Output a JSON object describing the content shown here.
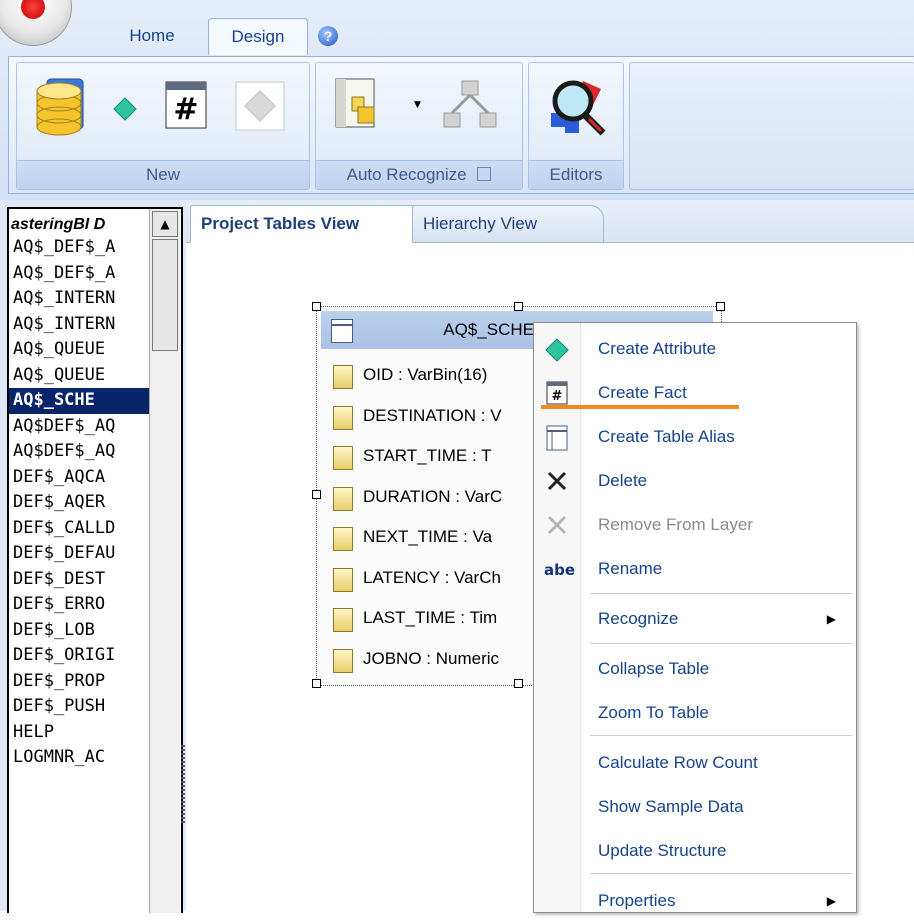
{
  "ribbon": {
    "tabs": [
      {
        "label": "Home"
      },
      {
        "label": "Design"
      }
    ],
    "help_glyph": "?",
    "groups": [
      {
        "label": "New"
      },
      {
        "label": "Auto Recognize"
      },
      {
        "label": "Editors"
      }
    ],
    "icons": [
      "database-icon",
      "attribute-diamond-icon",
      "fact-icon",
      "disabled-item-icon",
      "auto-recognize-icon",
      "hierarchy-icon",
      "editors-magnifier-icon"
    ]
  },
  "left_list": {
    "header": "asteringBI D",
    "items": [
      "AQ$_DEF$_A",
      "AQ$_DEF$_A",
      "AQ$_INTERN",
      "AQ$_INTERN",
      "AQ$_QUEUE",
      "AQ$_QUEUE",
      "AQ$_SCHE",
      "AQ$DEF$_AQ",
      "AQ$DEF$_AQ",
      "DEF$_AQCA",
      "DEF$_AQER",
      "DEF$_CALLD",
      "DEF$_DEFAU",
      "DEF$_DEST",
      "DEF$_ERRO",
      "DEF$_LOB",
      "DEF$_ORIGI",
      "DEF$_PROP",
      "DEF$_PUSH",
      "HELP",
      "LOGMNR_AC"
    ],
    "selected_index": 6
  },
  "view_tabs": [
    {
      "label": "Project Tables View"
    },
    {
      "label": "Hierarchy View"
    }
  ],
  "table": {
    "title": "AQ$_SCHEDULES",
    "columns": [
      "OID : VarBin(16)",
      "DESTINATION : V",
      "START_TIME : T",
      "DURATION : VarC",
      "NEXT_TIME : Va",
      "LATENCY : VarCh",
      "LAST_TIME : Tim",
      "JOBNO : Numeric"
    ]
  },
  "context_menu": {
    "items": [
      {
        "label": "Create Attribute",
        "icon": "diamond-icon",
        "disabled": false
      },
      {
        "label": "Create Fact",
        "icon": "fact-icon",
        "disabled": false
      },
      {
        "label": "Create Table Alias",
        "icon": "table-alias-icon",
        "disabled": false
      },
      {
        "label": "Delete",
        "icon": "delete-x-icon",
        "disabled": false
      },
      {
        "label": "Remove From Layer",
        "icon": "remove-x-icon",
        "disabled": true
      },
      {
        "label": "Rename",
        "icon": "rename-icon",
        "disabled": false
      },
      {
        "label": "Recognize",
        "submenu": true
      },
      {
        "label": "Collapse Table"
      },
      {
        "label": "Zoom To Table"
      },
      {
        "label": "Calculate Row Count"
      },
      {
        "label": "Show Sample Data"
      },
      {
        "label": "Update Structure"
      },
      {
        "label": "Properties",
        "submenu": true
      }
    ],
    "rename_icon_text": "abe",
    "submenu_arrow": "▶"
  },
  "colors": {
    "menu_text": "#15428b",
    "selection": "#0a246a",
    "highlight_underline": "#f08a1a"
  }
}
